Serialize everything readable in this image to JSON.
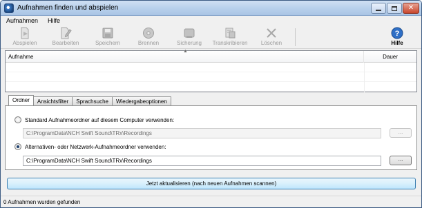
{
  "window": {
    "title": "Aufnahmen finden und abspielen"
  },
  "menu": [
    "Aufnahmen",
    "Hilfe"
  ],
  "toolbar": {
    "items": [
      {
        "label": "Abspielen",
        "icon": "play-document-icon",
        "enabled": false
      },
      {
        "label": "Bearbeiten",
        "icon": "edit-document-icon",
        "enabled": false
      },
      {
        "label": "Speichern",
        "icon": "save-disk-icon",
        "enabled": false
      },
      {
        "label": "Brennen",
        "icon": "burn-disc-icon",
        "enabled": false
      },
      {
        "label": "Sicherung",
        "icon": "backup-icon",
        "enabled": false
      },
      {
        "label": "Transkribieren",
        "icon": "transcribe-icon",
        "enabled": false
      },
      {
        "label": "Löschen",
        "icon": "delete-x-icon",
        "enabled": false
      },
      {
        "label": "Hilfe",
        "icon": "help-icon",
        "enabled": true
      }
    ]
  },
  "list": {
    "columns": [
      "Aufnahme",
      "Dauer"
    ],
    "rows": []
  },
  "tabs": [
    "Ordner",
    "Ansichtsfilter",
    "Sprachsuche",
    "Wiedergabeoptionen"
  ],
  "folder": {
    "standard_label": "Standard Aufnahmeordner auf diesem Computer verwenden:",
    "standard_path": "C:\\ProgramData\\NCH Swift Sound\\TRx\\Recordings",
    "alt_label": "Alternativen- oder Netzwerk-Aufnahmeordner verwenden:",
    "alt_path": "C:\\ProgramData\\NCH Swift Sound\\TRx\\Recordings",
    "browse_label": "...",
    "selected": "alternative"
  },
  "scan_button": "Jetzt aktualisieren (nach neuen Aufnahmen scannen)",
  "status": "0 Aufnahmen wurden gefunden"
}
